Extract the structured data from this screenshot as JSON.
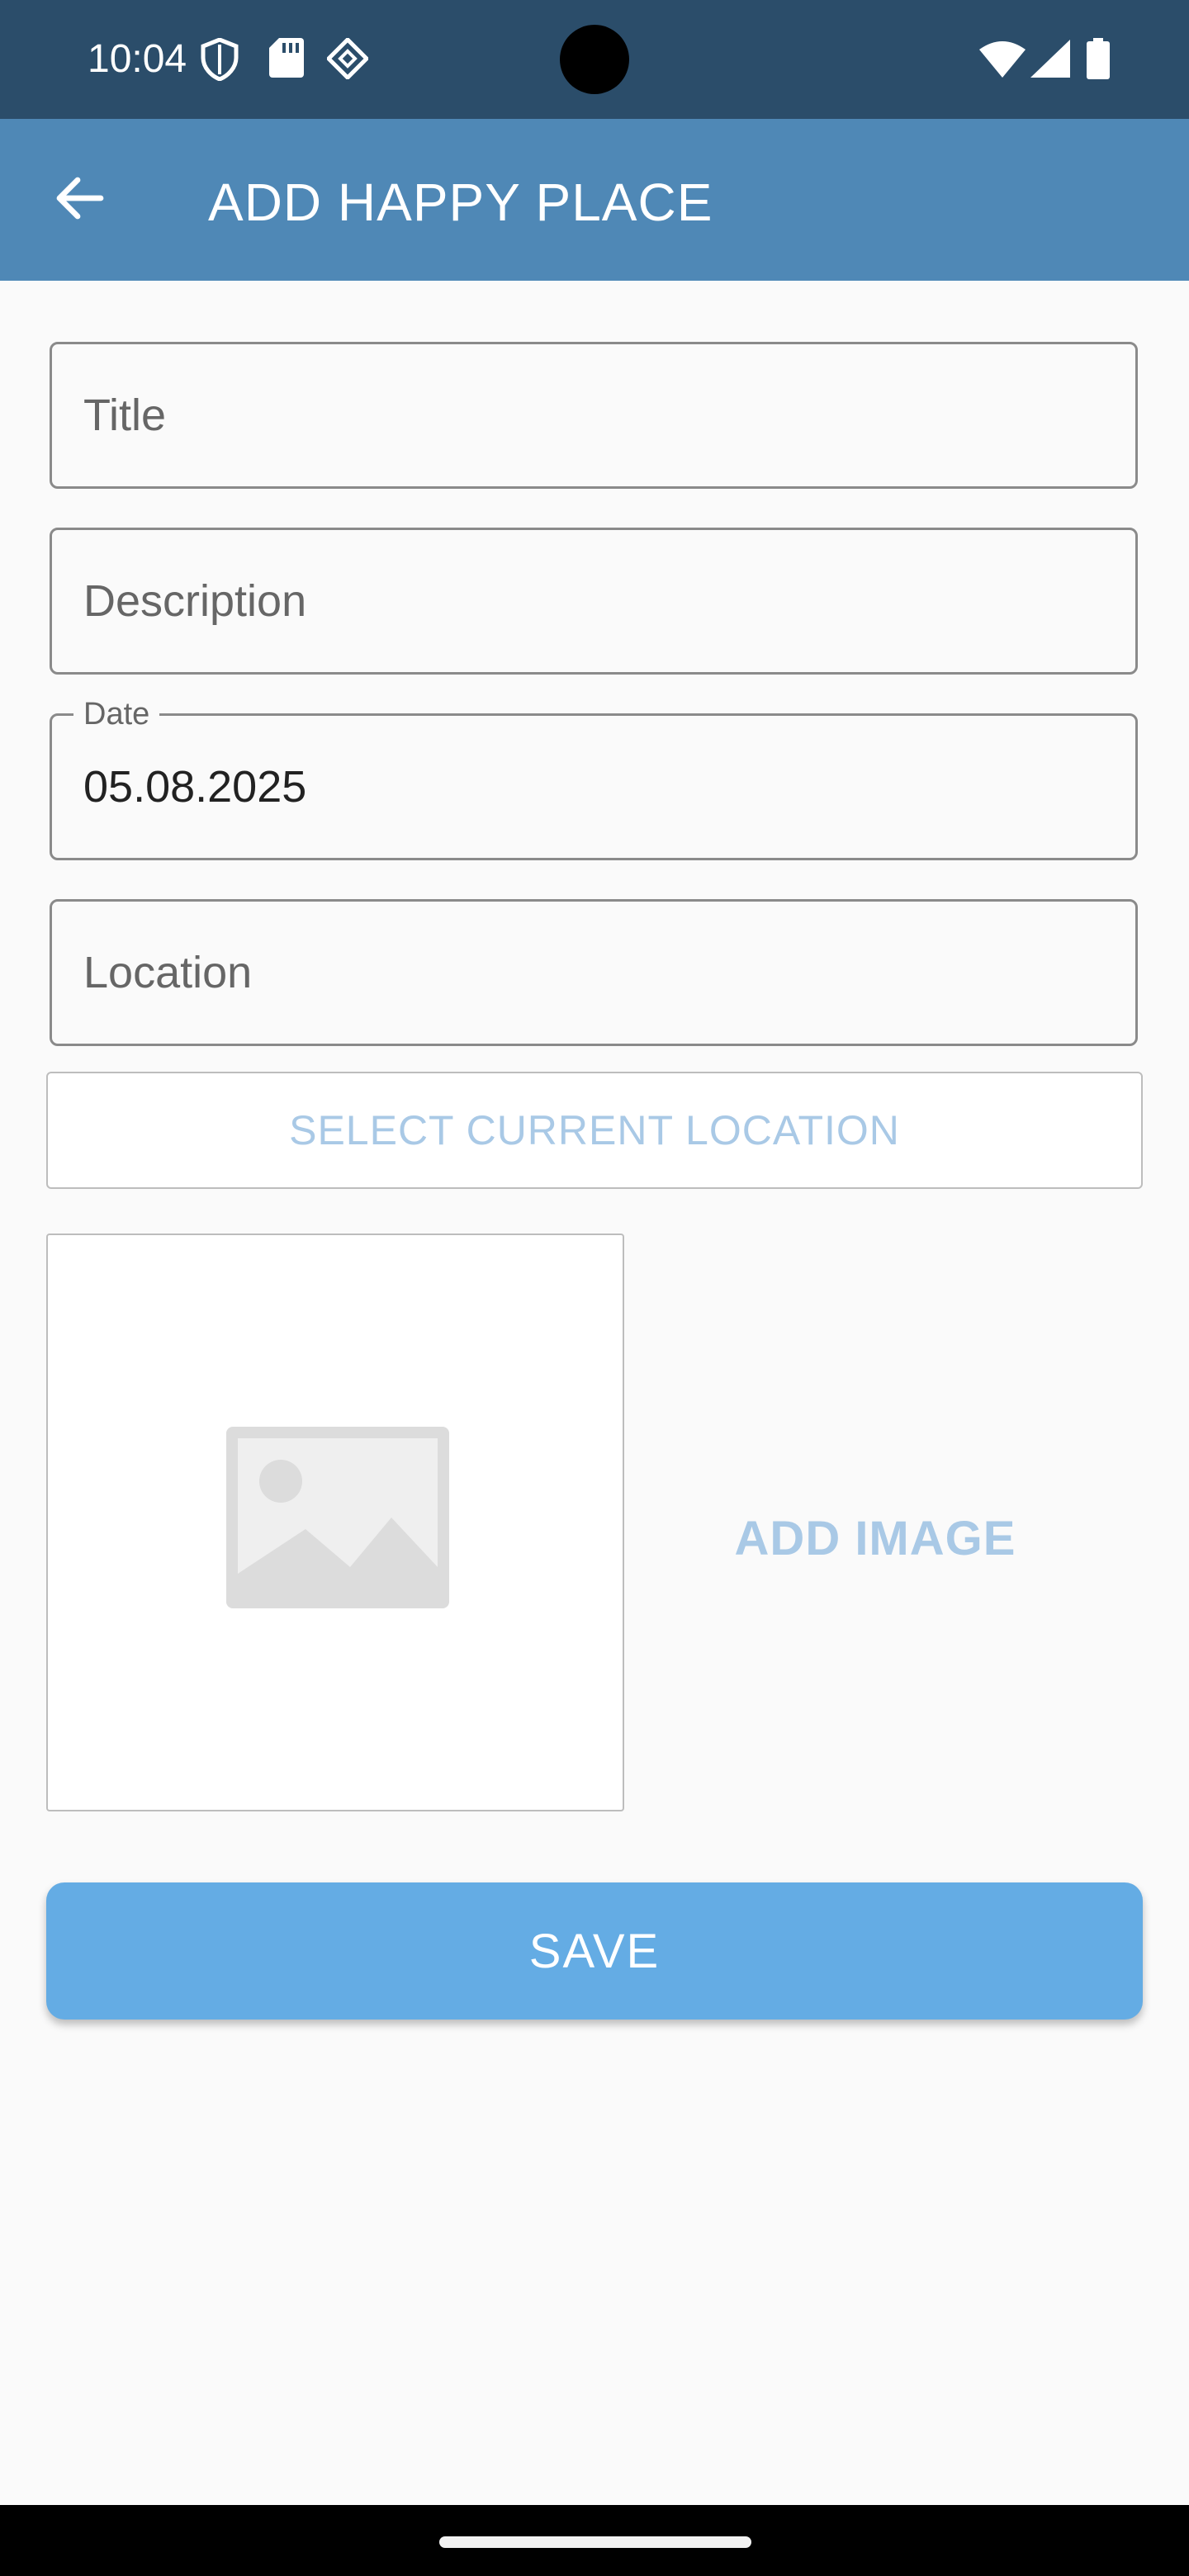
{
  "status_bar": {
    "time": "10:04",
    "icons": [
      "shield-icon",
      "sd-card-icon",
      "app-notification-icon",
      "wifi-icon",
      "cell-signal-icon",
      "battery-icon"
    ]
  },
  "app_bar": {
    "title": "ADD HAPPY PLACE",
    "back_icon": "arrow-back-icon"
  },
  "form": {
    "title": {
      "placeholder": "Title",
      "value": ""
    },
    "description": {
      "placeholder": "Description",
      "value": ""
    },
    "date": {
      "label": "Date",
      "value": "05.08.2025"
    },
    "location": {
      "placeholder": "Location",
      "value": ""
    },
    "select_location_label": "SELECT CURRENT LOCATION",
    "image_placeholder_icon": "image-placeholder-icon",
    "add_image_label": "ADD IMAGE",
    "save_label": "SAVE"
  },
  "colors": {
    "status_bar": "#2b4d6a",
    "app_bar": "#4f88b6",
    "save_button": "#64ace4",
    "muted_accent_text": "#a9c9e6"
  }
}
